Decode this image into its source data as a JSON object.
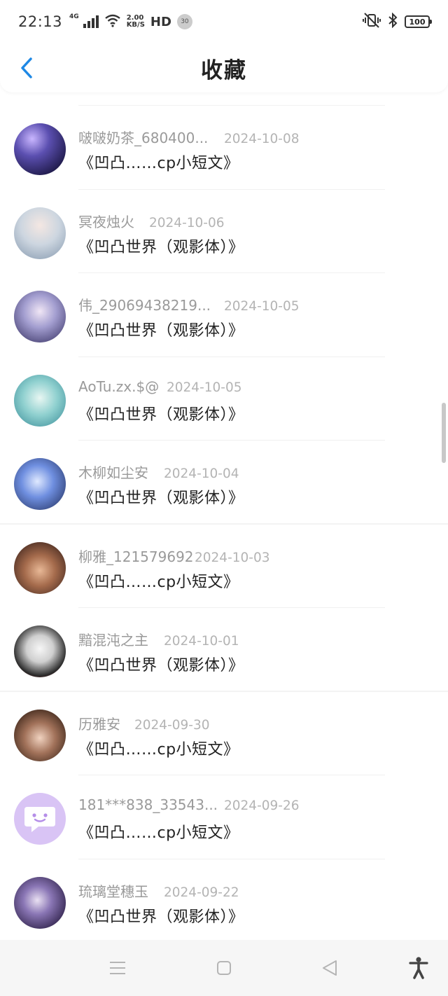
{
  "status_bar": {
    "time": "22:13",
    "network": "4G",
    "speed_value": "2.00",
    "speed_unit": "KB/S",
    "hd": "HD",
    "notification_count": "30",
    "battery": "100"
  },
  "header": {
    "title": "收藏",
    "back_icon": "chevron-left-icon"
  },
  "favorites": [
    {
      "user": "啵啵奶茶_680400...",
      "date": "2024-10-08",
      "title": "《凹凸……cp小短文》",
      "avatar_color": "#3a2f7a"
    },
    {
      "user": "冥夜烛火",
      "date": "2024-10-06",
      "title": "《凹凸世界（观影体）》",
      "avatar_color": "#b8c6cf"
    },
    {
      "user": "伟_29069438219...",
      "date": "2024-10-05",
      "title": "《凹凸世界（观影体）》",
      "avatar_color": "#6d6a9e"
    },
    {
      "user": "AoTu.zx.$@",
      "date": "2024-10-05",
      "title": "《凹凸世界（观影体）》",
      "avatar_color": "#7dc4c9"
    },
    {
      "user": "木柳如尘安",
      "date": "2024-10-04",
      "title": "《凹凸世界（观影体）》",
      "avatar_color": "#4b6fc0"
    },
    {
      "user": "柳雅_121579692",
      "date": "2024-10-03",
      "title": "《凹凸……cp小短文》",
      "avatar_color": "#6a3a2e"
    },
    {
      "user": "黯混沌之主",
      "date": "2024-10-01",
      "title": "《凹凸世界（观影体）》",
      "avatar_color": "#2a2a2a"
    },
    {
      "user": "历雅安",
      "date": "2024-09-30",
      "title": "《凹凸……cp小短文》",
      "avatar_color": "#5b3c2a"
    },
    {
      "user": "181***838_33543...",
      "date": "2024-09-26",
      "title": "《凹凸……cp小短文》",
      "avatar_color": "#d9c4f5"
    },
    {
      "user": "琉璃堂穗玉",
      "date": "2024-09-22",
      "title": "《凹凸世界（观影体）》",
      "avatar_color": "#3c2b5a"
    }
  ],
  "nav_bar": {
    "menu_icon": "menu-icon",
    "home_icon": "home-square-icon",
    "back_icon": "back-triangle-icon",
    "accessibility_icon": "accessibility-icon"
  },
  "colors": {
    "accent": "#1e88e5",
    "meta_text": "#999999",
    "title_text": "#222222"
  }
}
